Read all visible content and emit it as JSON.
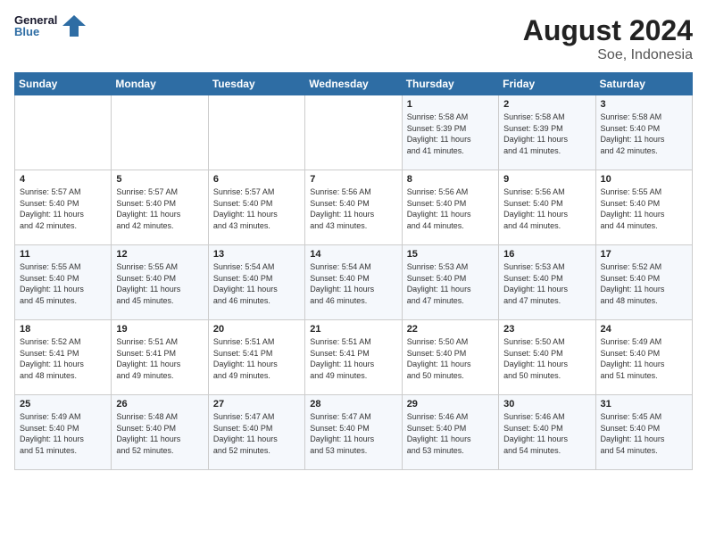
{
  "header": {
    "logo_general": "General",
    "logo_blue": "Blue",
    "main_title": "August 2024",
    "sub_title": "Soe, Indonesia"
  },
  "days_of_week": [
    "Sunday",
    "Monday",
    "Tuesday",
    "Wednesday",
    "Thursday",
    "Friday",
    "Saturday"
  ],
  "weeks": [
    [
      {
        "day": "",
        "info": ""
      },
      {
        "day": "",
        "info": ""
      },
      {
        "day": "",
        "info": ""
      },
      {
        "day": "",
        "info": ""
      },
      {
        "day": "1",
        "info": "Sunrise: 5:58 AM\nSunset: 5:39 PM\nDaylight: 11 hours\nand 41 minutes."
      },
      {
        "day": "2",
        "info": "Sunrise: 5:58 AM\nSunset: 5:39 PM\nDaylight: 11 hours\nand 41 minutes."
      },
      {
        "day": "3",
        "info": "Sunrise: 5:58 AM\nSunset: 5:40 PM\nDaylight: 11 hours\nand 42 minutes."
      }
    ],
    [
      {
        "day": "4",
        "info": "Sunrise: 5:57 AM\nSunset: 5:40 PM\nDaylight: 11 hours\nand 42 minutes."
      },
      {
        "day": "5",
        "info": "Sunrise: 5:57 AM\nSunset: 5:40 PM\nDaylight: 11 hours\nand 42 minutes."
      },
      {
        "day": "6",
        "info": "Sunrise: 5:57 AM\nSunset: 5:40 PM\nDaylight: 11 hours\nand 43 minutes."
      },
      {
        "day": "7",
        "info": "Sunrise: 5:56 AM\nSunset: 5:40 PM\nDaylight: 11 hours\nand 43 minutes."
      },
      {
        "day": "8",
        "info": "Sunrise: 5:56 AM\nSunset: 5:40 PM\nDaylight: 11 hours\nand 44 minutes."
      },
      {
        "day": "9",
        "info": "Sunrise: 5:56 AM\nSunset: 5:40 PM\nDaylight: 11 hours\nand 44 minutes."
      },
      {
        "day": "10",
        "info": "Sunrise: 5:55 AM\nSunset: 5:40 PM\nDaylight: 11 hours\nand 44 minutes."
      }
    ],
    [
      {
        "day": "11",
        "info": "Sunrise: 5:55 AM\nSunset: 5:40 PM\nDaylight: 11 hours\nand 45 minutes."
      },
      {
        "day": "12",
        "info": "Sunrise: 5:55 AM\nSunset: 5:40 PM\nDaylight: 11 hours\nand 45 minutes."
      },
      {
        "day": "13",
        "info": "Sunrise: 5:54 AM\nSunset: 5:40 PM\nDaylight: 11 hours\nand 46 minutes."
      },
      {
        "day": "14",
        "info": "Sunrise: 5:54 AM\nSunset: 5:40 PM\nDaylight: 11 hours\nand 46 minutes."
      },
      {
        "day": "15",
        "info": "Sunrise: 5:53 AM\nSunset: 5:40 PM\nDaylight: 11 hours\nand 47 minutes."
      },
      {
        "day": "16",
        "info": "Sunrise: 5:53 AM\nSunset: 5:40 PM\nDaylight: 11 hours\nand 47 minutes."
      },
      {
        "day": "17",
        "info": "Sunrise: 5:52 AM\nSunset: 5:40 PM\nDaylight: 11 hours\nand 48 minutes."
      }
    ],
    [
      {
        "day": "18",
        "info": "Sunrise: 5:52 AM\nSunset: 5:41 PM\nDaylight: 11 hours\nand 48 minutes."
      },
      {
        "day": "19",
        "info": "Sunrise: 5:51 AM\nSunset: 5:41 PM\nDaylight: 11 hours\nand 49 minutes."
      },
      {
        "day": "20",
        "info": "Sunrise: 5:51 AM\nSunset: 5:41 PM\nDaylight: 11 hours\nand 49 minutes."
      },
      {
        "day": "21",
        "info": "Sunrise: 5:51 AM\nSunset: 5:41 PM\nDaylight: 11 hours\nand 49 minutes."
      },
      {
        "day": "22",
        "info": "Sunrise: 5:50 AM\nSunset: 5:40 PM\nDaylight: 11 hours\nand 50 minutes."
      },
      {
        "day": "23",
        "info": "Sunrise: 5:50 AM\nSunset: 5:40 PM\nDaylight: 11 hours\nand 50 minutes."
      },
      {
        "day": "24",
        "info": "Sunrise: 5:49 AM\nSunset: 5:40 PM\nDaylight: 11 hours\nand 51 minutes."
      }
    ],
    [
      {
        "day": "25",
        "info": "Sunrise: 5:49 AM\nSunset: 5:40 PM\nDaylight: 11 hours\nand 51 minutes."
      },
      {
        "day": "26",
        "info": "Sunrise: 5:48 AM\nSunset: 5:40 PM\nDaylight: 11 hours\nand 52 minutes."
      },
      {
        "day": "27",
        "info": "Sunrise: 5:47 AM\nSunset: 5:40 PM\nDaylight: 11 hours\nand 52 minutes."
      },
      {
        "day": "28",
        "info": "Sunrise: 5:47 AM\nSunset: 5:40 PM\nDaylight: 11 hours\nand 53 minutes."
      },
      {
        "day": "29",
        "info": "Sunrise: 5:46 AM\nSunset: 5:40 PM\nDaylight: 11 hours\nand 53 minutes."
      },
      {
        "day": "30",
        "info": "Sunrise: 5:46 AM\nSunset: 5:40 PM\nDaylight: 11 hours\nand 54 minutes."
      },
      {
        "day": "31",
        "info": "Sunrise: 5:45 AM\nSunset: 5:40 PM\nDaylight: 11 hours\nand 54 minutes."
      }
    ]
  ]
}
